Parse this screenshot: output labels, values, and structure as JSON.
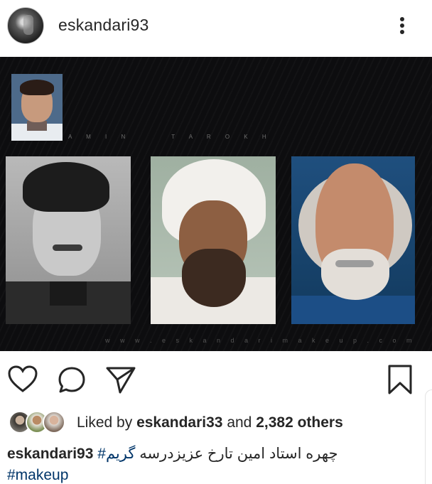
{
  "header": {
    "username": "eskandari93",
    "avatar_icon": "profile-avatar",
    "more_icon": "more-vertical-icon"
  },
  "post_image": {
    "credit_text": "A M I N     T A R O K H",
    "watermark_text": "w w w . e s k a n d a r i m a k e u p . c o m"
  },
  "actions": {
    "like_icon": "heart-outline-icon",
    "comment_icon": "comment-bubble-icon",
    "share_icon": "paper-plane-icon",
    "save_icon": "bookmark-outline-icon"
  },
  "likes": {
    "prefix": "Liked by",
    "user": "eskandari33",
    "middle": "and",
    "count": "2,382 others"
  },
  "caption": {
    "username": "eskandari93",
    "hashtag_fa": "#گریم",
    "text_fa": "چهره استاد امین تارخ عزیزدرسه",
    "hashtag_en": "#makeup"
  },
  "colors": {
    "text": "#262626",
    "hashtag": "#003569",
    "image_background": "#0d0d0f"
  }
}
